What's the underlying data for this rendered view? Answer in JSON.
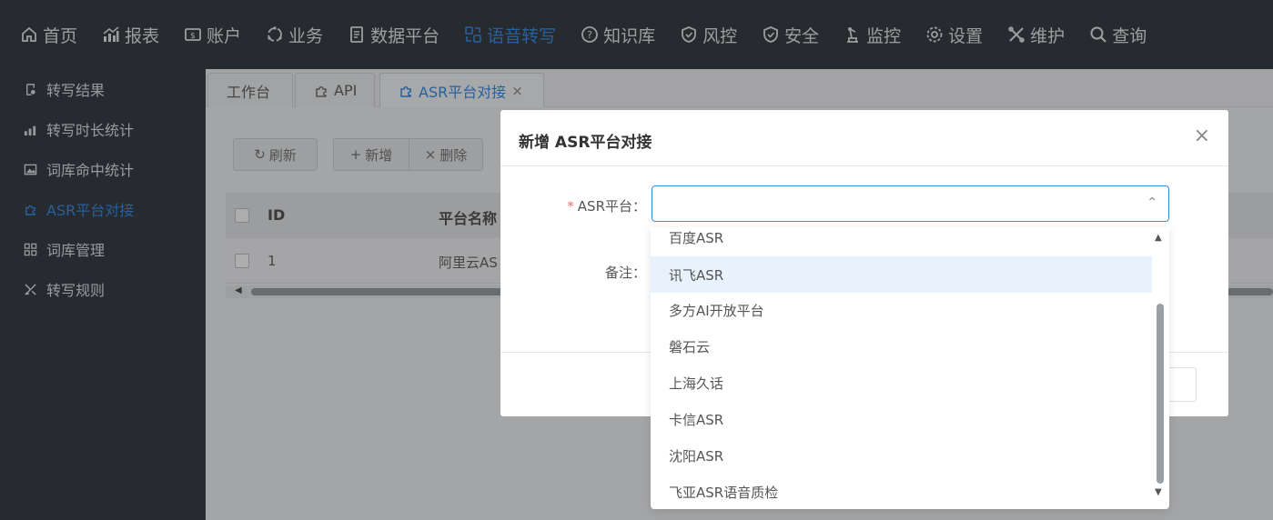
{
  "topnav": {
    "items": [
      {
        "label": "首页",
        "icon": "home-icon"
      },
      {
        "label": "报表",
        "icon": "chart-icon"
      },
      {
        "label": "账户",
        "icon": "account-icon"
      },
      {
        "label": "业务",
        "icon": "business-icon"
      },
      {
        "label": "数据平台",
        "icon": "document-icon"
      },
      {
        "label": "语音转写",
        "icon": "voice-transcribe-icon",
        "active": true
      },
      {
        "label": "知识库",
        "icon": "help-icon"
      },
      {
        "label": "风控",
        "icon": "shield-icon"
      },
      {
        "label": "安全",
        "icon": "shield-check-icon"
      },
      {
        "label": "监控",
        "icon": "monitor-icon"
      },
      {
        "label": "设置",
        "icon": "gear-icon"
      },
      {
        "label": "维护",
        "icon": "tools-icon"
      },
      {
        "label": "查询",
        "icon": "search-icon"
      }
    ]
  },
  "sidebar": {
    "items": [
      {
        "label": "转写结果"
      },
      {
        "label": "转写时长统计"
      },
      {
        "label": "词库命中统计"
      },
      {
        "label": "ASR平台对接",
        "active": true
      },
      {
        "label": "词库管理"
      },
      {
        "label": "转写规则"
      }
    ]
  },
  "tabs": [
    {
      "label": "工作台"
    },
    {
      "label": "API"
    },
    {
      "label": "ASR平台对接",
      "active": true
    }
  ],
  "toolbar": {
    "refresh_label": "刷新",
    "add_label": "新增",
    "delete_label": "删除"
  },
  "table": {
    "columns": [
      "ID",
      "平台名称"
    ],
    "rows": [
      {
        "id": "1",
        "name": "阿里云AS"
      }
    ]
  },
  "modal": {
    "title": "新增 ASR平台对接",
    "close_symbol": "×",
    "platform_label": "ASR平台：",
    "remark_label": "备注：",
    "required_mark": "*",
    "select_value": ""
  },
  "dropdown": {
    "options": [
      "百度ASR",
      "讯飞ASR",
      "多方AI开放平台",
      "磐石云",
      "上海久话",
      "卡信ASR",
      "沈阳ASR",
      "飞亚ASR语音质检"
    ],
    "hovered_index": 1
  },
  "colors": {
    "accent": "#3a8ee6",
    "nav_bg": "#3a4047",
    "required": "#f56c6c",
    "hover_bg": "#e8f2fc"
  }
}
